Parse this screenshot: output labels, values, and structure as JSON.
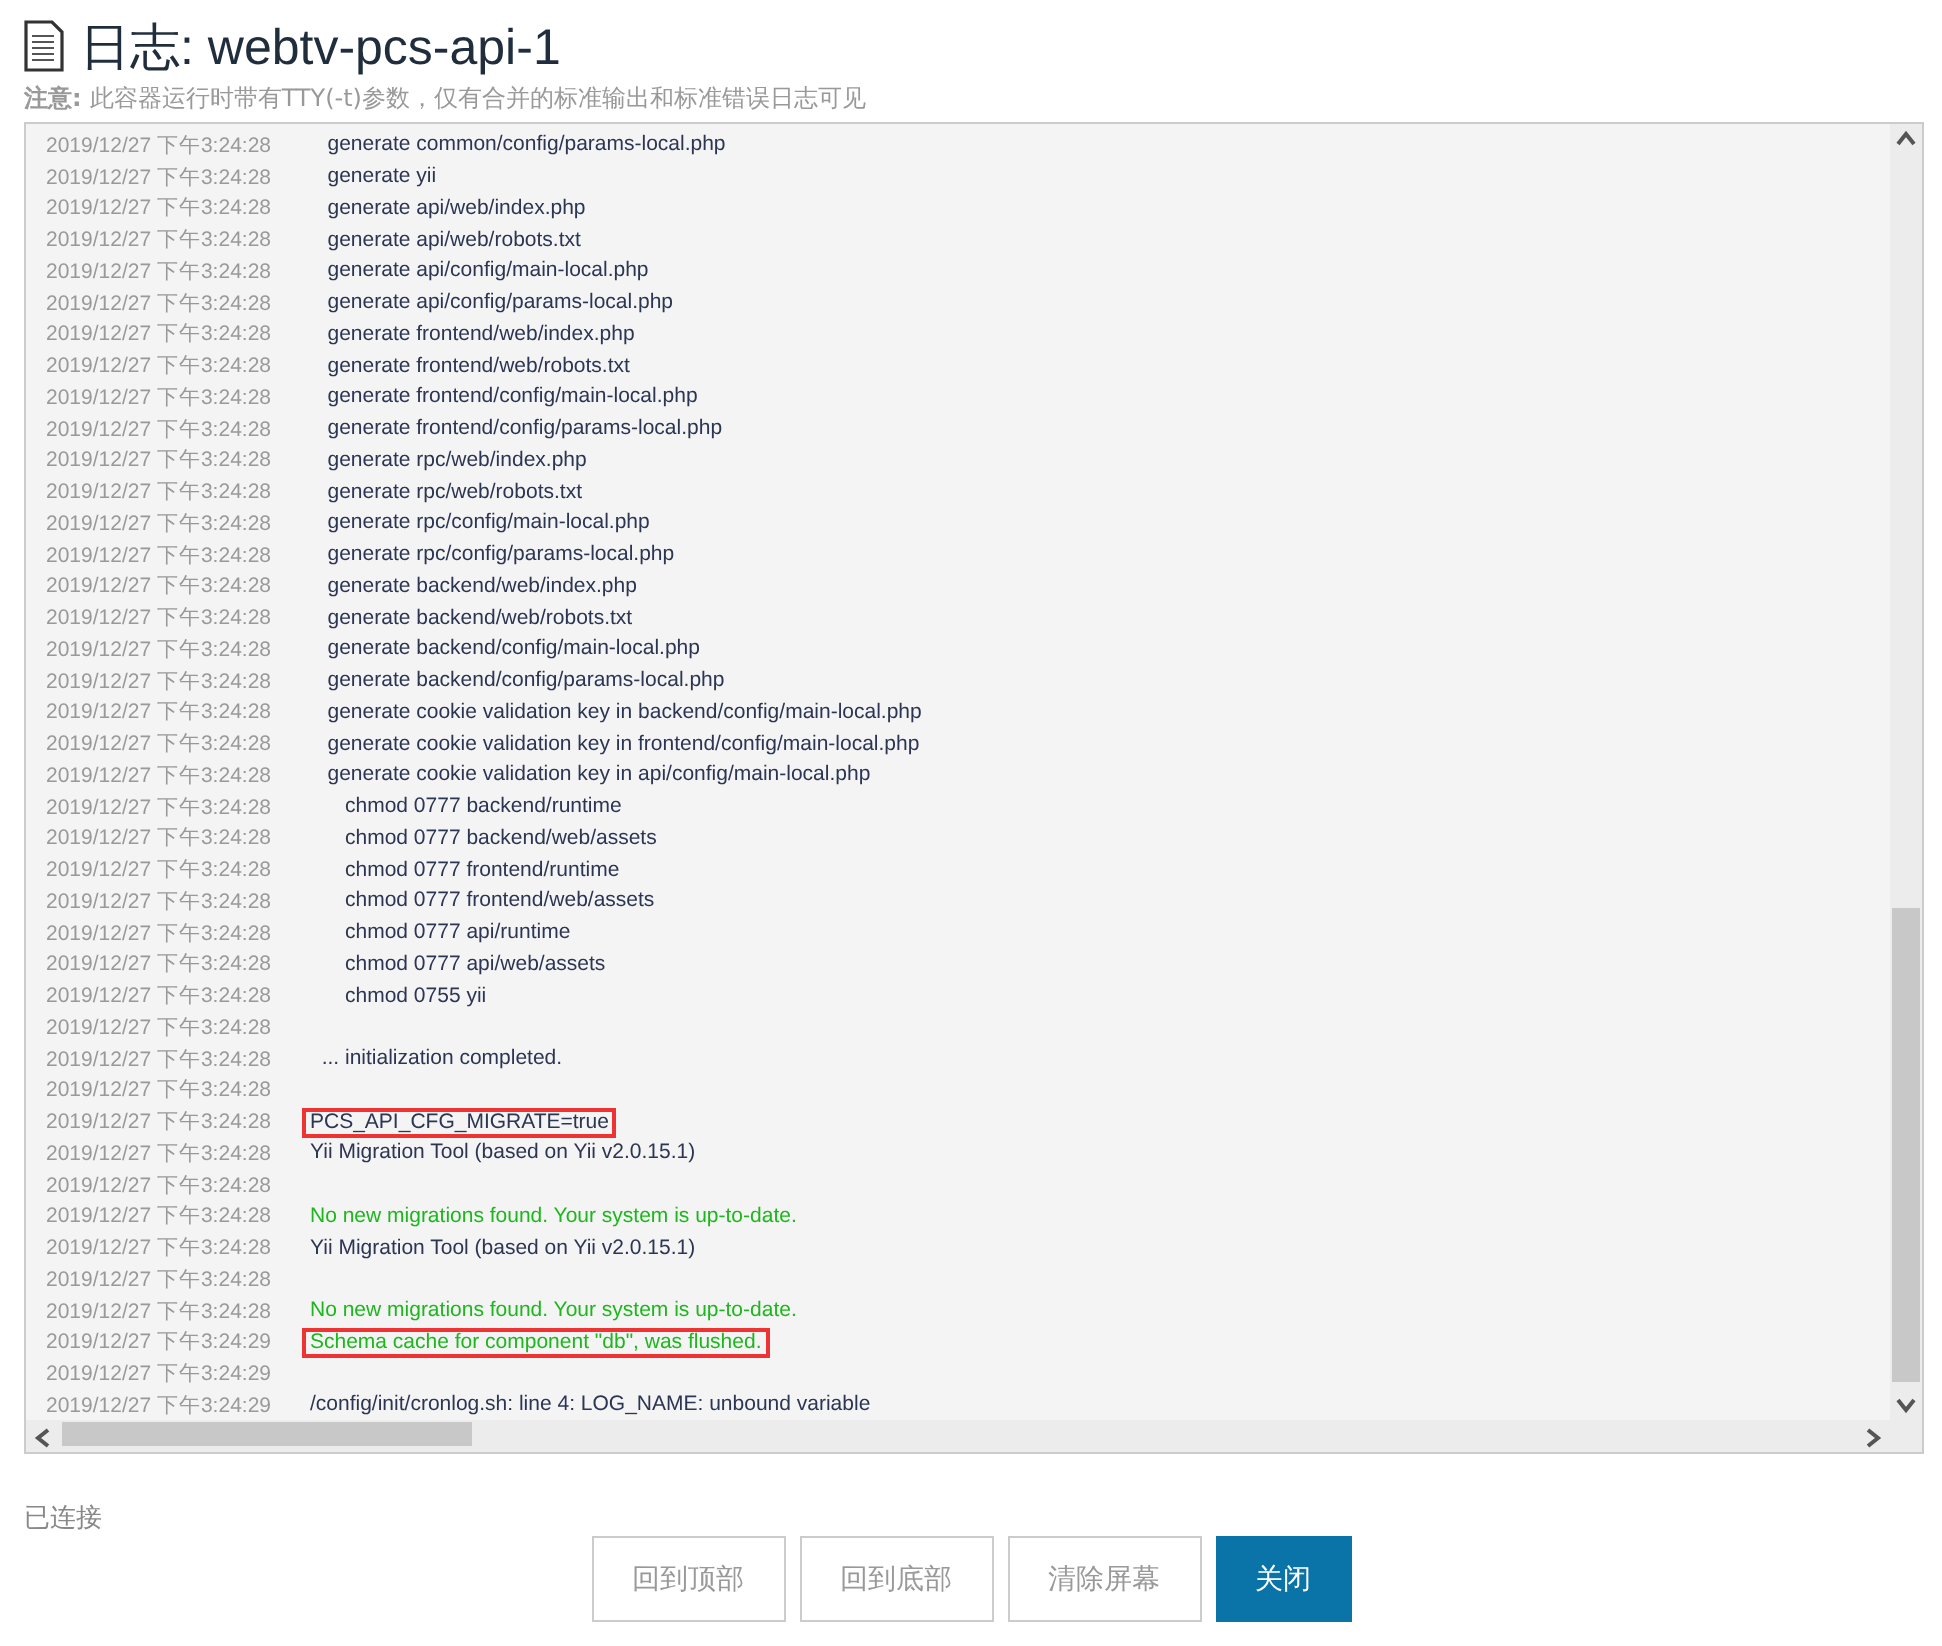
{
  "title": "日志: webtv-pcs-api-1",
  "note": {
    "label": "注意:",
    "text": "此容器运行时带有TTY(-t)参数，仅有合并的标准输出和标准错误日志可见"
  },
  "log": [
    {
      "time": "2019/12/27 下午3:24:28",
      "message": "   generate common/config/params-local.php",
      "kind": "normal",
      "highlighted": false
    },
    {
      "time": "2019/12/27 下午3:24:28",
      "message": "   generate yii",
      "kind": "normal",
      "highlighted": false
    },
    {
      "time": "2019/12/27 下午3:24:28",
      "message": "   generate api/web/index.php",
      "kind": "normal",
      "highlighted": false
    },
    {
      "time": "2019/12/27 下午3:24:28",
      "message": "   generate api/web/robots.txt",
      "kind": "normal",
      "highlighted": false
    },
    {
      "time": "2019/12/27 下午3:24:28",
      "message": "   generate api/config/main-local.php",
      "kind": "normal",
      "highlighted": false
    },
    {
      "time": "2019/12/27 下午3:24:28",
      "message": "   generate api/config/params-local.php",
      "kind": "normal",
      "highlighted": false
    },
    {
      "time": "2019/12/27 下午3:24:28",
      "message": "   generate frontend/web/index.php",
      "kind": "normal",
      "highlighted": false
    },
    {
      "time": "2019/12/27 下午3:24:28",
      "message": "   generate frontend/web/robots.txt",
      "kind": "normal",
      "highlighted": false
    },
    {
      "time": "2019/12/27 下午3:24:28",
      "message": "   generate frontend/config/main-local.php",
      "kind": "normal",
      "highlighted": false
    },
    {
      "time": "2019/12/27 下午3:24:28",
      "message": "   generate frontend/config/params-local.php",
      "kind": "normal",
      "highlighted": false
    },
    {
      "time": "2019/12/27 下午3:24:28",
      "message": "   generate rpc/web/index.php",
      "kind": "normal",
      "highlighted": false
    },
    {
      "time": "2019/12/27 下午3:24:28",
      "message": "   generate rpc/web/robots.txt",
      "kind": "normal",
      "highlighted": false
    },
    {
      "time": "2019/12/27 下午3:24:28",
      "message": "   generate rpc/config/main-local.php",
      "kind": "normal",
      "highlighted": false
    },
    {
      "time": "2019/12/27 下午3:24:28",
      "message": "   generate rpc/config/params-local.php",
      "kind": "normal",
      "highlighted": false
    },
    {
      "time": "2019/12/27 下午3:24:28",
      "message": "   generate backend/web/index.php",
      "kind": "normal",
      "highlighted": false
    },
    {
      "time": "2019/12/27 下午3:24:28",
      "message": "   generate backend/web/robots.txt",
      "kind": "normal",
      "highlighted": false
    },
    {
      "time": "2019/12/27 下午3:24:28",
      "message": "   generate backend/config/main-local.php",
      "kind": "normal",
      "highlighted": false
    },
    {
      "time": "2019/12/27 下午3:24:28",
      "message": "   generate backend/config/params-local.php",
      "kind": "normal",
      "highlighted": false
    },
    {
      "time": "2019/12/27 下午3:24:28",
      "message": "   generate cookie validation key in backend/config/main-local.php",
      "kind": "normal",
      "highlighted": false
    },
    {
      "time": "2019/12/27 下午3:24:28",
      "message": "   generate cookie validation key in frontend/config/main-local.php",
      "kind": "normal",
      "highlighted": false
    },
    {
      "time": "2019/12/27 下午3:24:28",
      "message": "   generate cookie validation key in api/config/main-local.php",
      "kind": "normal",
      "highlighted": false
    },
    {
      "time": "2019/12/27 下午3:24:28",
      "message": "      chmod 0777 backend/runtime",
      "kind": "normal",
      "highlighted": false
    },
    {
      "time": "2019/12/27 下午3:24:28",
      "message": "      chmod 0777 backend/web/assets",
      "kind": "normal",
      "highlighted": false
    },
    {
      "time": "2019/12/27 下午3:24:28",
      "message": "      chmod 0777 frontend/runtime",
      "kind": "normal",
      "highlighted": false
    },
    {
      "time": "2019/12/27 下午3:24:28",
      "message": "      chmod 0777 frontend/web/assets",
      "kind": "normal",
      "highlighted": false
    },
    {
      "time": "2019/12/27 下午3:24:28",
      "message": "      chmod 0777 api/runtime",
      "kind": "normal",
      "highlighted": false
    },
    {
      "time": "2019/12/27 下午3:24:28",
      "message": "      chmod 0777 api/web/assets",
      "kind": "normal",
      "highlighted": false
    },
    {
      "time": "2019/12/27 下午3:24:28",
      "message": "      chmod 0755 yii",
      "kind": "normal",
      "highlighted": false
    },
    {
      "time": "2019/12/27 下午3:24:28"
    },
    {
      "time": "2019/12/27 下午3:24:28",
      "message": "  ... initialization completed.",
      "kind": "normal",
      "highlighted": false
    },
    {
      "time": "2019/12/27 下午3:24:28"
    },
    {
      "time": "2019/12/27 下午3:24:28",
      "message": "PCS_API_CFG_MIGRATE=true",
      "kind": "normal",
      "highlighted": true
    },
    {
      "time": "2019/12/27 下午3:24:28",
      "message": "Yii Migration Tool (based on Yii v2.0.15.1)",
      "kind": "normal",
      "highlighted": false
    },
    {
      "time": "2019/12/27 下午3:24:28"
    },
    {
      "time": "2019/12/27 下午3:24:28",
      "message": "No new migrations found. Your system is up-to-date.",
      "kind": "success",
      "highlighted": false
    },
    {
      "time": "2019/12/27 下午3:24:28",
      "message": "Yii Migration Tool (based on Yii v2.0.15.1)",
      "kind": "normal",
      "highlighted": false
    },
    {
      "time": "2019/12/27 下午3:24:28"
    },
    {
      "time": "2019/12/27 下午3:24:28",
      "message": "No new migrations found. Your system is up-to-date.",
      "kind": "success",
      "highlighted": false
    },
    {
      "time": "2019/12/27 下午3:24:29",
      "message": "Schema cache for component \"db\", was flushed.",
      "kind": "success",
      "highlighted": true
    },
    {
      "time": "2019/12/27 下午3:24:29"
    },
    {
      "time": "2019/12/27 下午3:24:29",
      "message": "/config/init/cronlog.sh: line 4: LOG_NAME: unbound variable",
      "kind": "normal",
      "highlighted": false
    }
  ],
  "status": "已连接",
  "buttons": [
    {
      "label": "回到顶部",
      "kind": "default"
    },
    {
      "label": "回到底部",
      "kind": "default"
    },
    {
      "label": "清除屏幕",
      "kind": "default"
    },
    {
      "label": "关闭",
      "kind": "primary"
    }
  ]
}
